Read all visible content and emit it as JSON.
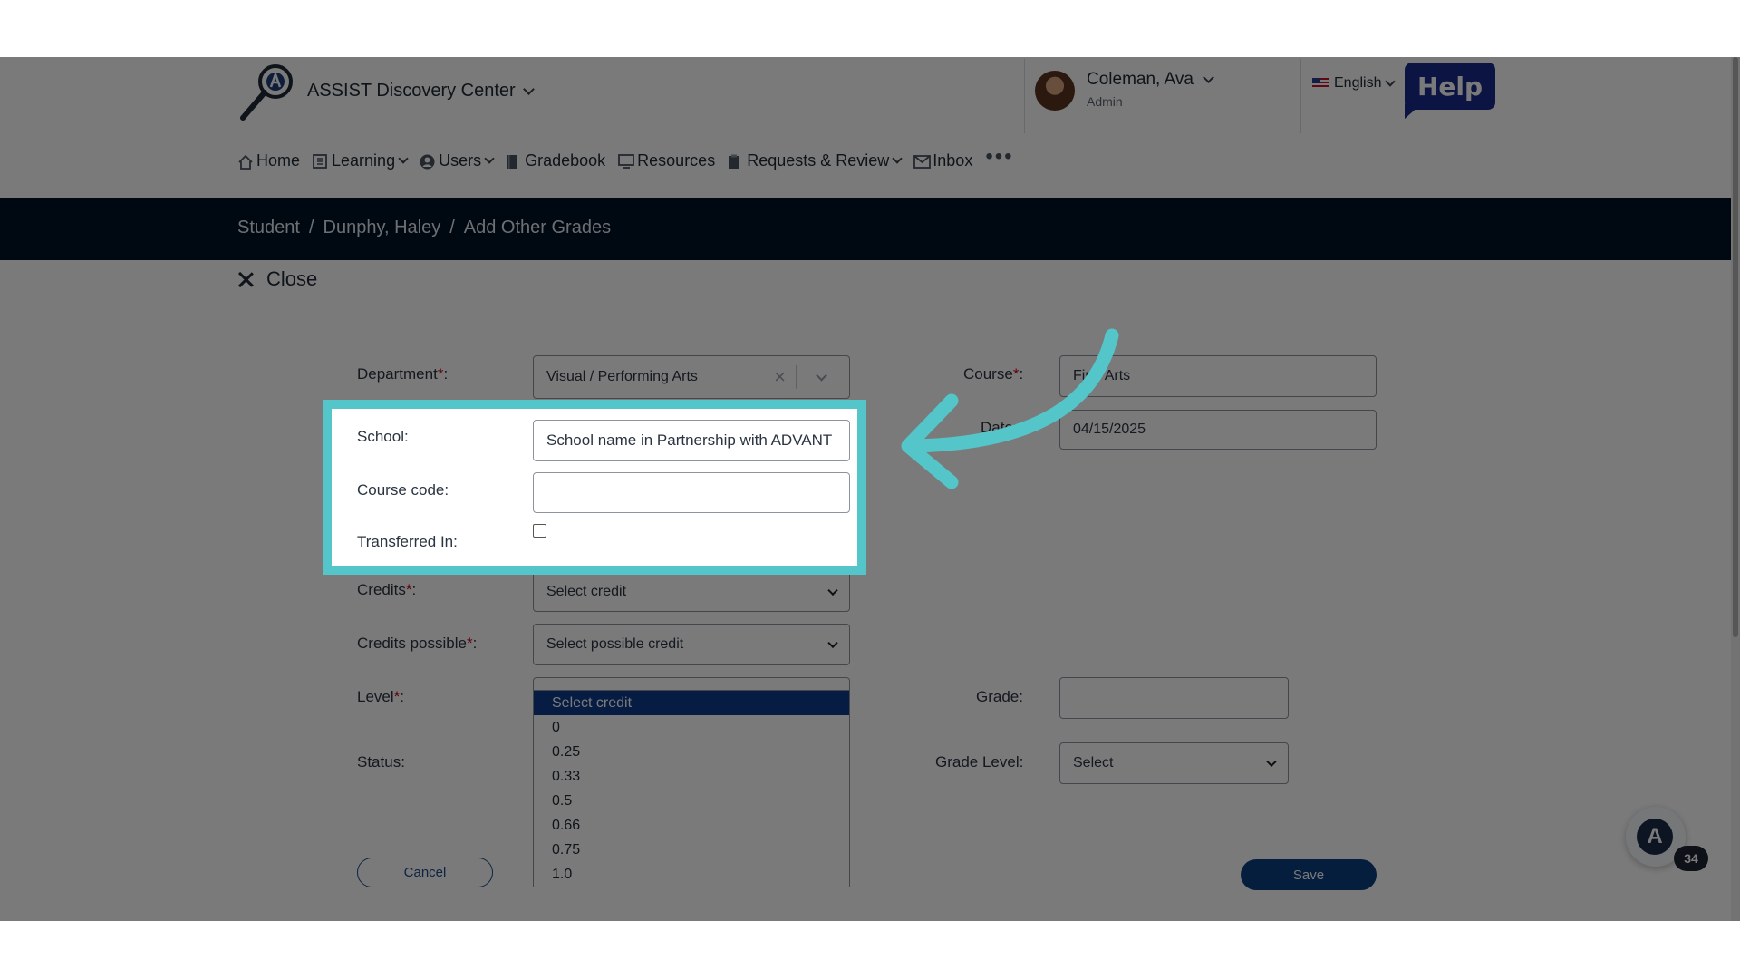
{
  "app": {
    "brand": "ASSIST Discovery Center",
    "user_name": "Coleman, Ava",
    "user_role": "Admin",
    "language": "English",
    "help_label": "Help"
  },
  "nav": {
    "home": "Home",
    "learning": "Learning",
    "users": "Users",
    "gradebook": "Gradebook",
    "resources": "Resources",
    "requests": "Requests & Review",
    "inbox": "Inbox",
    "more": "•••"
  },
  "breadcrumb": {
    "student": "Student",
    "name": "Dunphy, Haley",
    "page": "Add Other Grades",
    "sep": "/"
  },
  "form": {
    "close_label": "Close",
    "department_label": "Department",
    "department_value": "Visual / Performing Arts",
    "course_label": "Course",
    "course_value": "Fine Arts",
    "school_label": "School",
    "school_value": "School name in Partnership with ADVANT",
    "date_label": "Date",
    "date_value": "04/15/2025",
    "course_code_label": "Course code",
    "course_code_value": "",
    "transferred_label": "Transferred In",
    "credits_label": "Credits",
    "credits_value": "Select credit",
    "credits_possible_label": "Credits possible",
    "credits_possible_value": "Select possible credit",
    "level_label": "Level",
    "grade_label": "Grade",
    "grade_value": "",
    "status_label": "Status",
    "grade_level_label": "Grade Level",
    "grade_level_value": "Select",
    "required_mark": "*",
    "colon": ":",
    "cancel_label": "Cancel",
    "save_label": "Save"
  },
  "level_options": [
    "Select credit",
    "0",
    "0.25",
    "0.33",
    "0.5",
    "0.66",
    "0.75",
    "1.0"
  ],
  "chat": {
    "badge_count": "34",
    "logo_letter": "A"
  },
  "colors": {
    "banner": "#011125",
    "highlight": "#54c5c8",
    "primary_button": "#0b3f7f",
    "help": "#1a2a8f"
  }
}
